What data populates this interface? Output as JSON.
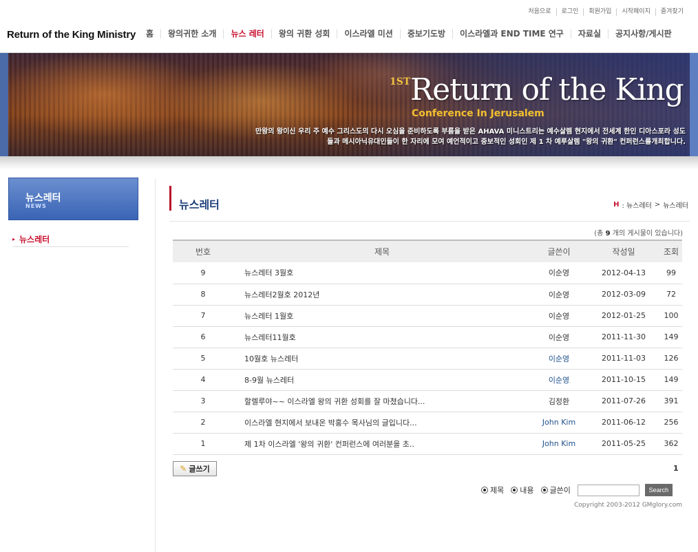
{
  "util_links": [
    "처음으로",
    "로그인",
    "회원가입",
    "시작페이지",
    "즐겨찾기"
  ],
  "logo": "Return of the King Ministry",
  "gnb": [
    "홈",
    "왕의귀한 소개",
    "뉴스 레터",
    "왕의 귀환 성회",
    "이스라엘 미션",
    "중보기도방",
    "이스라엘과 END TIME 연구",
    "자료실",
    "공지사항/게시판"
  ],
  "banner": {
    "pre": "1ST",
    "title": "Return of the King",
    "subtitle": "Conference In Jerusalem",
    "desc1": "만왕의 왕이신 우리 주 예수 그리스도의 다시 오심을 준비하도록 부름을 받은 AHAVA 미니스트리는 예수살렘 현지에서 전세계 한인 디아스포라 성도",
    "desc2": "들과 메시아닉유대인들이 한 자리에 모여 예언적이고 중보적인 성회인 제 1 차 예루살렘 \"왕의 귀환\" 컨퍼런스를개최합니다."
  },
  "side": {
    "title": "뉴스레터",
    "title_en": "NEWS",
    "menu_item": "뉴스레터"
  },
  "page": {
    "title": "뉴스레터",
    "crumb_h": "H",
    "crumb_1": ": 뉴스레터",
    "crumb_sep": ">",
    "crumb_2": "뉴스레터",
    "total_prefix": "(총",
    "total_count": "9",
    "total_suffix": "개의 게시물이 있습니다)"
  },
  "table": {
    "headers": [
      "번호",
      "제목",
      "글쓴이",
      "작성일",
      "조회"
    ],
    "rows": [
      {
        "no": "9",
        "subject": "뉴스레터 3월호",
        "author": "이순영",
        "date": "2012-04-13",
        "views": "99",
        "blue": false
      },
      {
        "no": "8",
        "subject": "뉴스레터2월호 2012년",
        "author": "이순영",
        "date": "2012-03-09",
        "views": "72",
        "blue": false
      },
      {
        "no": "7",
        "subject": "뉴스레터 1월호",
        "author": "이순영",
        "date": "2012-01-25",
        "views": "100",
        "blue": false
      },
      {
        "no": "6",
        "subject": "뉴스레터11월호",
        "author": "이순영",
        "date": "2011-11-30",
        "views": "149",
        "blue": false
      },
      {
        "no": "5",
        "subject": "10월호 뉴스레터",
        "author": "이순영",
        "date": "2011-11-03",
        "views": "126",
        "blue": true
      },
      {
        "no": "4",
        "subject": "8-9월 뉴스레터",
        "author": "이순영",
        "date": "2011-10-15",
        "views": "149",
        "blue": true
      },
      {
        "no": "3",
        "subject": "할렐루야~~ 이스라엘 왕의 귀환 성회를 잘 마쳤습니다...",
        "author": "김정환",
        "date": "2011-07-26",
        "views": "391",
        "blue": false
      },
      {
        "no": "2",
        "subject": "이스라엘 현지에서 보내온 박홍수 목사님의 글입니다...",
        "author": "John Kim",
        "date": "2011-06-12",
        "views": "256",
        "blue": true
      },
      {
        "no": "1",
        "subject": "제 1차 이스라엘 '왕의 귀환' 컨퍼런스에 여러분을 초..",
        "author": "John Kim",
        "date": "2011-05-25",
        "views": "362",
        "blue": true
      }
    ]
  },
  "write_label": "글쓰기",
  "pager_current": "1",
  "search": {
    "opt1": "제목",
    "opt2": "내용",
    "opt3": "글쓴이",
    "input_value": "",
    "button": "Search"
  },
  "copyright": "Copyright 2003-2012 GMglory.com"
}
